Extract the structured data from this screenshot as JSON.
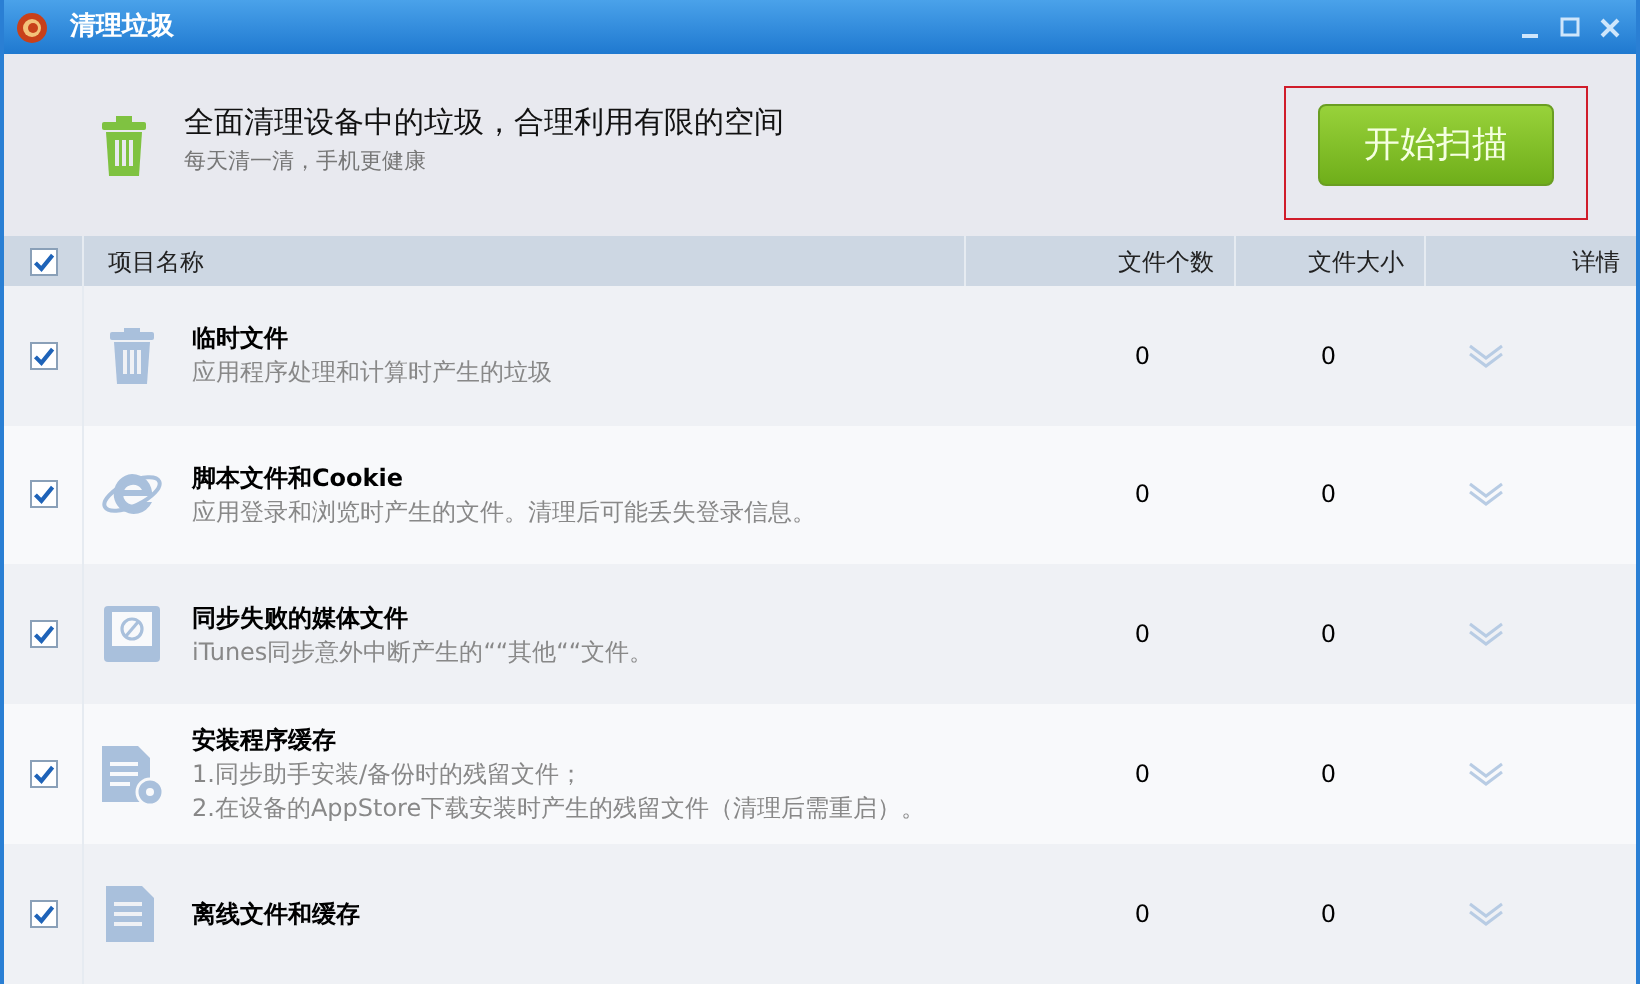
{
  "window": {
    "title": "清理垃圾"
  },
  "header": {
    "headline": "全面清理设备中的垃圾，合理利用有限的空间",
    "subline": "每天清一清，手机更健康",
    "scan_button": "开始扫描"
  },
  "table": {
    "select_all_checked": true,
    "columns": [
      "项目名称",
      "文件个数",
      "文件大小",
      "详情"
    ],
    "rows": [
      {
        "checked": true,
        "name": "临时文件",
        "description": [
          "应用程序处理和计算时产生的垃圾"
        ],
        "count": "0",
        "size": "0"
      },
      {
        "checked": true,
        "name": "脚本文件和Cookie",
        "description": [
          "应用登录和浏览时产生的文件。清理后可能丢失登录信息。"
        ],
        "count": "0",
        "size": "0"
      },
      {
        "checked": true,
        "name": "同步失败的媒体文件",
        "description": [
          "iTunes同步意外中断产生的““其他““文件。"
        ],
        "count": "0",
        "size": "0"
      },
      {
        "checked": true,
        "name": "安装程序缓存",
        "description": [
          "1.同步助手安装/备份时的残留文件；",
          "2.在设备的AppStore下载安装时产生的残留文件（清理后需重启）。"
        ],
        "count": "0",
        "size": "0"
      },
      {
        "checked": true,
        "name": "离线文件和缓存",
        "description": [],
        "count": "0",
        "size": "0"
      }
    ]
  }
}
